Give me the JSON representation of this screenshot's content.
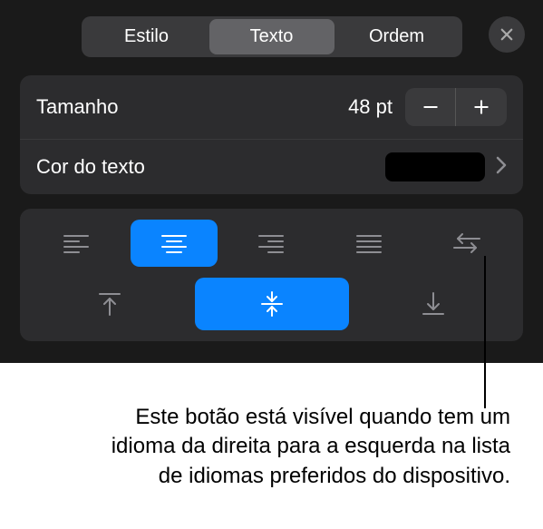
{
  "tabs": {
    "style": "Estilo",
    "text": "Texto",
    "order": "Ordem"
  },
  "size": {
    "label": "Tamanho",
    "value": "48 pt"
  },
  "textColor": {
    "label": "Cor do texto",
    "swatch": "#000000"
  },
  "callout": "Este botão está visível quando tem um idioma da direita para a esquerda na lista de idiomas preferidos do dispositivo."
}
